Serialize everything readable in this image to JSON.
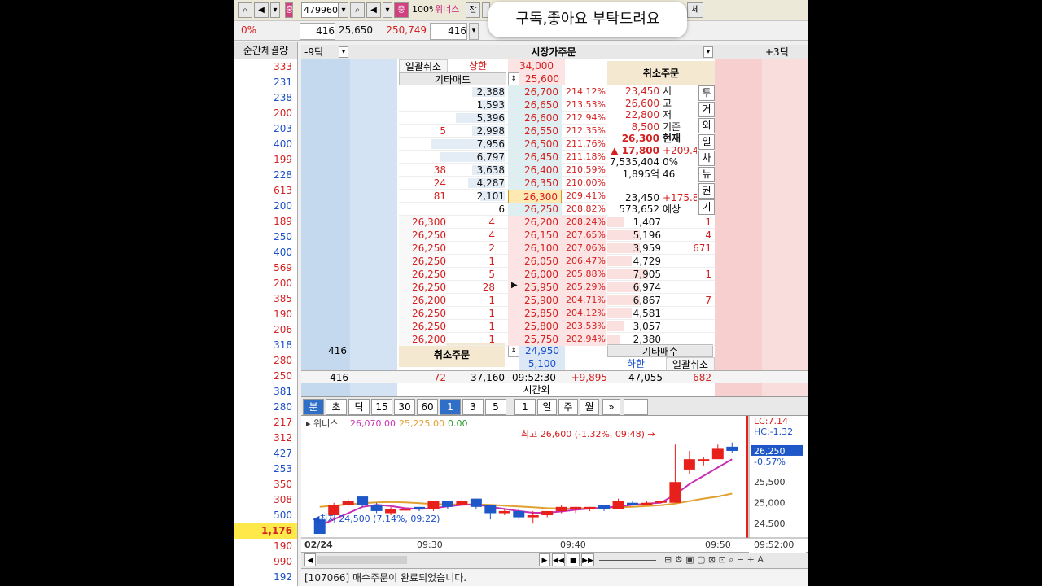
{
  "toolbar": {
    "code": "479960",
    "zoom_badge": "중",
    "percent": "100%",
    "stock_name": "위너스",
    "balance_btn": "잔",
    "all_btn": "체"
  },
  "row2": {
    "pct": "0%",
    "v1": "416",
    "v2": "25,650",
    "v3": "250,749",
    "v4": "416"
  },
  "popup": "구독,좋아요 부탁드려요",
  "left_column": {
    "header": "순간체결량",
    "values": [
      {
        "v": "333",
        "c": "red"
      },
      {
        "v": "231",
        "c": "blue"
      },
      {
        "v": "238",
        "c": "blue"
      },
      {
        "v": "200",
        "c": "red"
      },
      {
        "v": "203",
        "c": "blue"
      },
      {
        "v": "400",
        "c": "blue"
      },
      {
        "v": "199",
        "c": "red"
      },
      {
        "v": "228",
        "c": "blue"
      },
      {
        "v": "613",
        "c": "red"
      },
      {
        "v": "200",
        "c": "blue"
      },
      {
        "v": "189",
        "c": "red"
      },
      {
        "v": "250",
        "c": "blue"
      },
      {
        "v": "400",
        "c": "blue"
      },
      {
        "v": "569",
        "c": "red"
      },
      {
        "v": "200",
        "c": "red"
      },
      {
        "v": "385",
        "c": "red"
      },
      {
        "v": "190",
        "c": "red"
      },
      {
        "v": "206",
        "c": "red"
      },
      {
        "v": "318",
        "c": "blue"
      },
      {
        "v": "280",
        "c": "red"
      },
      {
        "v": "250",
        "c": "red"
      },
      {
        "v": "381",
        "c": "blue"
      },
      {
        "v": "280",
        "c": "blue"
      },
      {
        "v": "217",
        "c": "red"
      },
      {
        "v": "312",
        "c": "red"
      },
      {
        "v": "427",
        "c": "blue"
      },
      {
        "v": "253",
        "c": "blue"
      },
      {
        "v": "350",
        "c": "red"
      },
      {
        "v": "308",
        "c": "red"
      },
      {
        "v": "500",
        "c": "blue"
      },
      {
        "v": "1,176",
        "c": "red",
        "hl": true
      },
      {
        "v": "190",
        "c": "red"
      },
      {
        "v": "990",
        "c": "red"
      },
      {
        "v": "192",
        "c": "blue"
      }
    ]
  },
  "orderbook": {
    "left_hdr": "-9틱",
    "center_hdr": "시장가주문",
    "right_hdr": "+3틱",
    "bulk_cancel": "일괄취소",
    "upper_limit_label": "상한",
    "upper_limit": "34,000",
    "other_sell": "기타매도",
    "other_sell_val": "25,600",
    "cancel_order": "취소주문",
    "ask_rows": [
      {
        "q1": "",
        "q2": "2,388",
        "p": "26,700",
        "r": "214.12%"
      },
      {
        "q1": "",
        "q2": "1,593",
        "p": "26,650",
        "r": "213.53%"
      },
      {
        "q1": "",
        "q2": "5,396",
        "p": "26,600",
        "r": "212.94%"
      },
      {
        "q1": "5",
        "q2": "2,998",
        "p": "26,550",
        "r": "212.35%"
      },
      {
        "q1": "",
        "q2": "7,956",
        "p": "26,500",
        "r": "211.76%"
      },
      {
        "q1": "",
        "q2": "6,797",
        "p": "26,450",
        "r": "211.18%"
      },
      {
        "q1": "38",
        "q2": "3,638",
        "p": "26,400",
        "r": "210.59%"
      },
      {
        "q1": "24",
        "q2": "4,287",
        "p": "26,350",
        "r": "210.00%"
      },
      {
        "q1": "81",
        "q2": "2,101",
        "p": "26,300",
        "r": "209.41%"
      },
      {
        "q1": "",
        "q2": "6",
        "p": "26,250",
        "r": "208.82%"
      }
    ],
    "info": [
      {
        "v": "23,450",
        "k": "시"
      },
      {
        "v": "26,600",
        "k": "고"
      },
      {
        "v": "22,800",
        "k": "저"
      },
      {
        "v": "8,500",
        "k": "기준"
      },
      {
        "v": "26,300",
        "k": "현재"
      },
      {
        "v": "▲ 17,800",
        "k": "+209.4"
      },
      {
        "v": "7,535,404",
        "k": "0%"
      },
      {
        "v": "1,895억",
        "k": "46"
      },
      {
        "v": "",
        "k": ""
      },
      {
        "v": "23,450",
        "k": "+175.8"
      },
      {
        "v": "573,652",
        "k": "예상"
      }
    ],
    "side_tabs": [
      "투",
      "거",
      "외",
      "일",
      "차",
      "뉴",
      "권",
      "기"
    ],
    "bid_rows": [
      {
        "tp": "26,300",
        "tq": "4",
        "p": "26,200",
        "r": "208.24%",
        "q": "1,407",
        "q2": "1"
      },
      {
        "tp": "26,250",
        "tq": "4",
        "p": "26,150",
        "r": "207.65%",
        "q": "5,196",
        "q2": "4"
      },
      {
        "tp": "26,250",
        "tq": "2",
        "p": "26,100",
        "r": "207.06%",
        "q": "3,959",
        "q2": "671"
      },
      {
        "tp": "26,250",
        "tq": "1",
        "p": "26,050",
        "r": "206.47%",
        "q": "4,729",
        "q2": ""
      },
      {
        "tp": "26,250",
        "tq": "5",
        "p": "26,000",
        "r": "205.88%",
        "q": "7,905",
        "q2": "1"
      },
      {
        "tp": "26,250",
        "tq": "28",
        "p": "25,950",
        "r": "205.29%",
        "q": "6,974",
        "q2": ""
      },
      {
        "tp": "26,200",
        "tq": "1",
        "p": "25,900",
        "r": "204.71%",
        "q": "6,867",
        "q2": "7"
      },
      {
        "tp": "26,250",
        "tq": "1",
        "p": "25,850",
        "r": "204.12%",
        "q": "4,581",
        "q2": ""
      },
      {
        "tp": "26,250",
        "tq": "1",
        "p": "25,800",
        "r": "203.53%",
        "q": "3,057",
        "q2": ""
      },
      {
        "tp": "26,200",
        "tq": "1",
        "p": "25,750",
        "r": "202.94%",
        "q": "2,380",
        "q2": ""
      }
    ],
    "lower": {
      "left_qty": "416",
      "cancel_order": "취소주문",
      "p1": "24,950",
      "p2": "5,100",
      "other_buy": "기타매수",
      "lower_limit": "하한",
      "bulk_cancel": "일괄취소"
    },
    "totals": {
      "left": "416",
      "sell_cnt": "72",
      "sell_total": "37,160",
      "time": "09:52:30",
      "diff": "+9,895",
      "buy_total": "47,055",
      "buy_cnt": "682"
    },
    "after_hours": "시간외"
  },
  "tabs": [
    "분",
    "초",
    "틱",
    "15",
    "30",
    "60",
    "1",
    "3",
    "5",
    "1",
    "일",
    "주",
    "월"
  ],
  "chart_data": {
    "type": "candlestick",
    "stock": "위너스",
    "legend": [
      "26,070.00",
      "25,225.00",
      "0.00"
    ],
    "x_ticks": [
      "02/24",
      "09:30",
      "09:40",
      "09:50"
    ],
    "y_ticks": [
      26250,
      25500,
      25000,
      24500
    ],
    "ylim": [
      24250,
      26700
    ],
    "high_label": "최고 26,600 (-1.32%, 09:48)",
    "low_label": "최저 24,500 (7.14%, 09:22)",
    "lc_label": "LC:7.14",
    "hc_label": "HC:-1.32",
    "current_price": "26,250",
    "current_pct": "-0.57%",
    "time_label": "09:52:00",
    "candles": [
      {
        "o": 24600,
        "c": 24250,
        "h": 24600,
        "l": 24250
      },
      {
        "o": 24700,
        "c": 24950,
        "h": 25000,
        "l": 24700
      },
      {
        "o": 24950,
        "c": 25050,
        "h": 25100,
        "l": 24900
      },
      {
        "o": 25150,
        "c": 24950,
        "h": 25150,
        "l": 24900
      },
      {
        "o": 24950,
        "c": 24800,
        "h": 25000,
        "l": 24750
      },
      {
        "o": 24750,
        "c": 24850,
        "h": 24900,
        "l": 24700
      },
      {
        "o": 24850,
        "c": 24850,
        "h": 24900,
        "l": 24750
      },
      {
        "o": 24900,
        "c": 24850,
        "h": 24900,
        "l": 24800
      },
      {
        "o": 24850,
        "c": 25050,
        "h": 25050,
        "l": 24800
      },
      {
        "o": 25050,
        "c": 24900,
        "h": 25050,
        "l": 24850
      },
      {
        "o": 24950,
        "c": 25050,
        "h": 25100,
        "l": 24950
      },
      {
        "o": 25100,
        "c": 24900,
        "h": 25100,
        "l": 24850
      },
      {
        "o": 24950,
        "c": 24750,
        "h": 24950,
        "l": 24600
      },
      {
        "o": 24750,
        "c": 24800,
        "h": 24850,
        "l": 24700
      },
      {
        "o": 24800,
        "c": 24650,
        "h": 24850,
        "l": 24600
      },
      {
        "o": 24650,
        "c": 24700,
        "h": 24800,
        "l": 24500
      },
      {
        "o": 24700,
        "c": 24800,
        "h": 24800,
        "l": 24650
      },
      {
        "o": 24800,
        "c": 24900,
        "h": 24950,
        "l": 24750
      },
      {
        "o": 24850,
        "c": 24900,
        "h": 24900,
        "l": 24750
      },
      {
        "o": 24850,
        "c": 24900,
        "h": 24900,
        "l": 24800
      },
      {
        "o": 24950,
        "c": 24850,
        "h": 24950,
        "l": 24800
      },
      {
        "o": 24850,
        "c": 25050,
        "h": 25100,
        "l": 24850
      },
      {
        "o": 25000,
        "c": 24950,
        "h": 25050,
        "l": 24950
      },
      {
        "o": 24950,
        "c": 25000,
        "h": 25050,
        "l": 24950
      },
      {
        "o": 25000,
        "c": 25050,
        "h": 25050,
        "l": 25000
      },
      {
        "o": 25000,
        "c": 25500,
        "h": 26400,
        "l": 25000
      },
      {
        "o": 25800,
        "c": 26050,
        "h": 26250,
        "l": 25700
      },
      {
        "o": 26050,
        "c": 26050,
        "h": 26100,
        "l": 25900
      },
      {
        "o": 26050,
        "c": 26300,
        "h": 26400,
        "l": 26050
      },
      {
        "o": 26350,
        "c": 26250,
        "h": 26450,
        "l": 26200
      }
    ],
    "ma_fast": [
      24450,
      24600,
      24750,
      24900,
      24950,
      24920,
      24870,
      24850,
      24870,
      24910,
      24950,
      24960,
      24900,
      24850,
      24800,
      24760,
      24760,
      24790,
      24830,
      24860,
      24880,
      24910,
      24950,
      24980,
      25000,
      25200,
      25450,
      25650,
      25850,
      26050
    ],
    "ma_slow": [
      24900,
      24930,
      24960,
      24990,
      25010,
      25020,
      25010,
      24990,
      24970,
      24960,
      24960,
      24960,
      24950,
      24930,
      24910,
      24890,
      24870,
      24860,
      24860,
      24870,
      24880,
      24890,
      24900,
      24920,
      24940,
      24980,
      25040,
      25100,
      25150,
      25220
    ],
    "colors": {
      "up": "#e8201c",
      "down": "#1e58c8",
      "fast": "#c82fb4",
      "slow": "#e0a030"
    }
  },
  "bottombar": {
    "buttons": [
      "◀",
      "▶",
      "◀◀",
      "■",
      "▶▶"
    ]
  },
  "status": "[107066] 매수주문이 완료되었습니다."
}
